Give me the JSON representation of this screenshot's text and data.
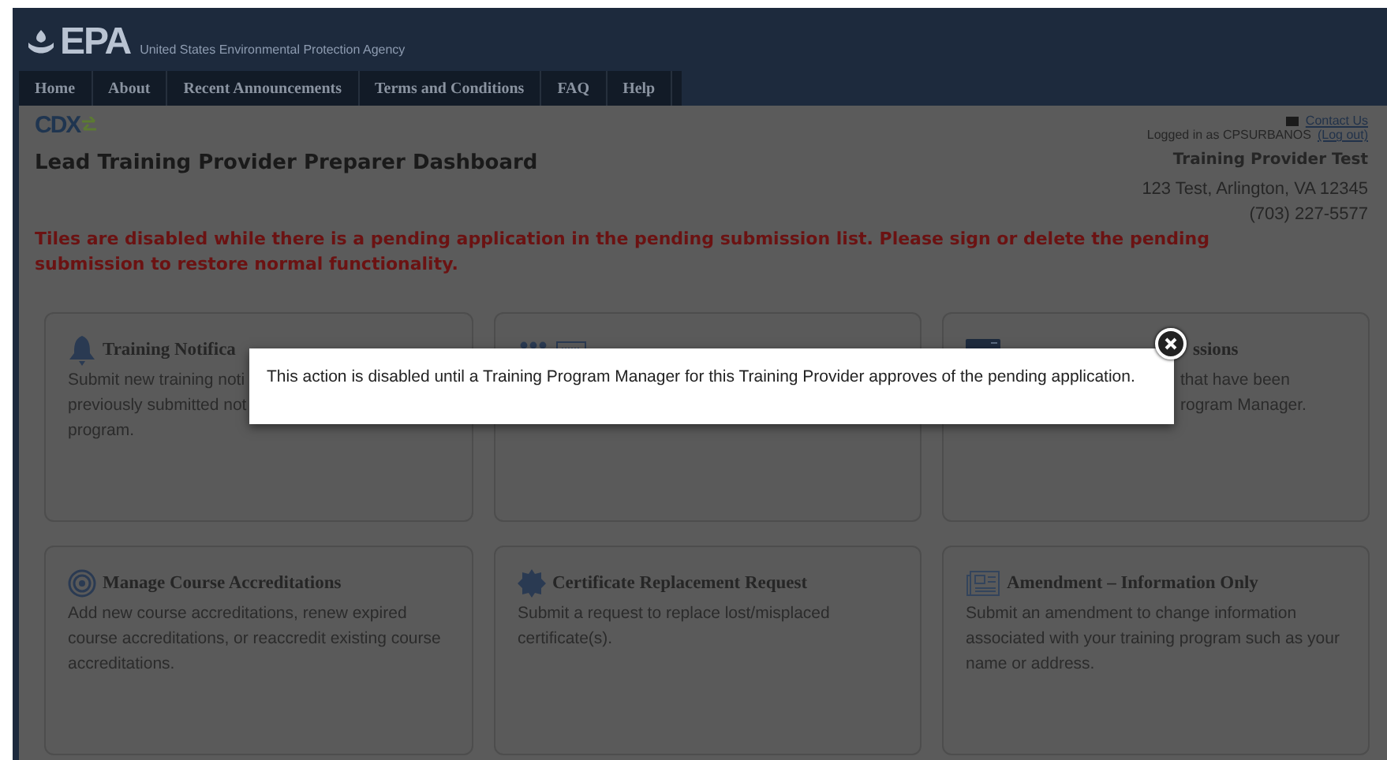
{
  "header": {
    "logo": "EPA",
    "agency": "United States Environmental Protection Agency"
  },
  "nav": [
    {
      "label": "Home"
    },
    {
      "label": "About"
    },
    {
      "label": "Recent Announcements"
    },
    {
      "label": "Terms and Conditions"
    },
    {
      "label": "FAQ"
    },
    {
      "label": "Help"
    }
  ],
  "cdx_logo": "CDX",
  "page_title": "Lead Training Provider Preparer Dashboard",
  "user_panel": {
    "contact": "Contact Us",
    "logged_in": "Logged in as CPSURBANOS",
    "logout": "(Log out)",
    "provider": "Training Provider Test",
    "address": "123 Test, Arlington, VA 12345",
    "phone": "(703) 227-5577"
  },
  "warning": "Tiles are disabled while there is a pending application in the pending submission list. Please sign or delete the pending submission to restore normal functionality.",
  "tiles": [
    {
      "kind": "cut-right",
      "title": "Training Notifica",
      "lines": [
        "Submit new training noti",
        "previously submitted not",
        "program."
      ]
    },
    {
      "kind": "hidden"
    },
    {
      "kind": "cut-left",
      "title": "ssions",
      "lines": [
        "that have been",
        "rogram Manager."
      ]
    },
    {
      "kind": "full",
      "title": "Manage Course Accreditations",
      "lines": [
        "Add new course accreditations, renew expired",
        "course accreditations, or reaccredit existing course",
        "accreditations."
      ]
    },
    {
      "kind": "full",
      "title": "Certificate Replacement Request",
      "lines": [
        "Submit a request to replace lost/misplaced",
        "certificate(s)."
      ]
    },
    {
      "kind": "full",
      "title": "Amendment – Information Only",
      "lines": [
        "Submit an amendment to change information",
        "associated with your training program such as your",
        "name or address."
      ]
    }
  ],
  "modal": {
    "message": "This action is disabled until a Training Program Manager for this Training Provider approves of the pending application."
  }
}
